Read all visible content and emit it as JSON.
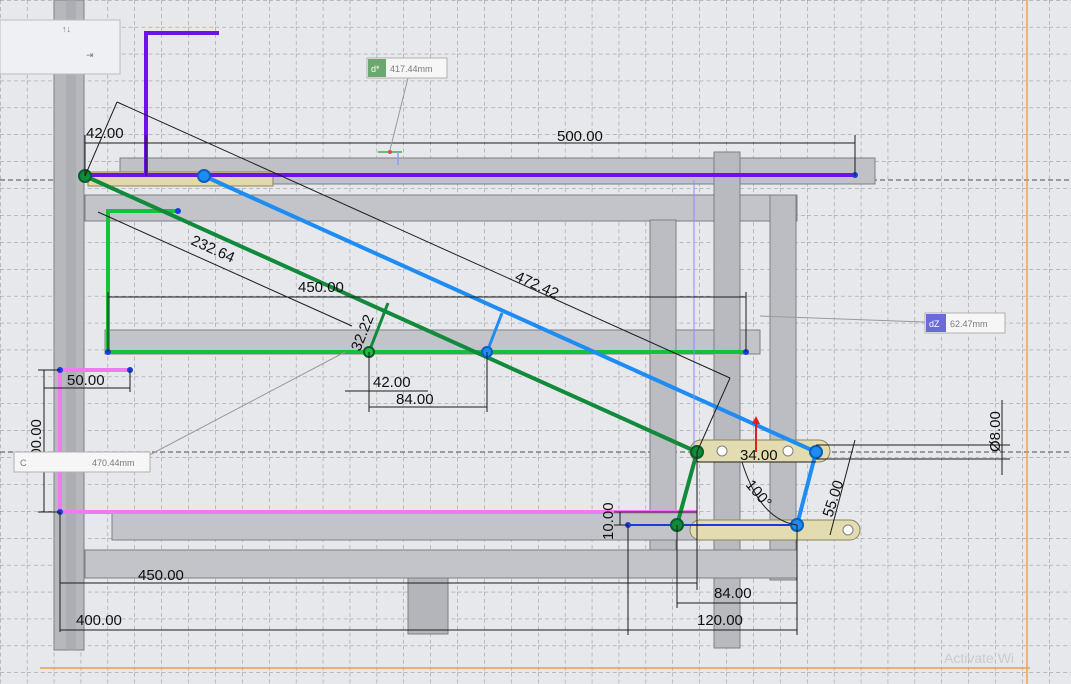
{
  "dimensions": {
    "d_top_left": "42.00",
    "d_top_span": "500.00",
    "d_diag_long": "472.42",
    "d_diag_green": "232.64",
    "d_green_span": "450.00",
    "d_small_angle": "32.22",
    "d_mid_42": "42.00",
    "d_mid_84": "84.00",
    "d_pink_50": "50.00",
    "d_pink_100": "100.00",
    "d_hole_34": "34.00",
    "d_angle_100": "100°",
    "d_link_55": "55.00",
    "d_dia_8": "Ø8.00",
    "d_offset_10": "10.00",
    "d_bottom_450": "450.00",
    "d_bottom_84": "84.00",
    "d_bottom_400": "400.00",
    "d_bottom_120": "120.00"
  },
  "tags": {
    "tag_top": "417.44mm",
    "tag_right": "62.47mm",
    "tag_left": "470.44mm",
    "tag_top_badge": "d*",
    "tag_right_badge": "dZ",
    "tag_left_badge": "C"
  },
  "watermark": "Activate Wi",
  "colors": {
    "purple": "#6c13ea",
    "blue": "#1e8cf5",
    "green_dark": "#128a3c",
    "green_light": "#14c23a",
    "pink": "#f07af0",
    "navy": "#1a3be0",
    "frame": "#9ea0a6"
  }
}
